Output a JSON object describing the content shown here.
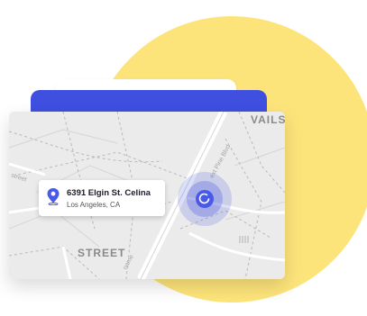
{
  "map": {
    "label_top": "VAILS",
    "label_bottom": "STREET",
    "road_labels": [
      "street",
      "ext Pine Blvd",
      "name"
    ]
  },
  "location": {
    "address": "6391 Elgin St. Celina",
    "city": "Los Angeles, CA"
  },
  "colors": {
    "accent": "#3f4fe0",
    "blob": "#fde47a",
    "pin": "#4a5ae8"
  },
  "icons": {
    "pin": "location-pin-icon",
    "locator": "current-location-icon"
  }
}
